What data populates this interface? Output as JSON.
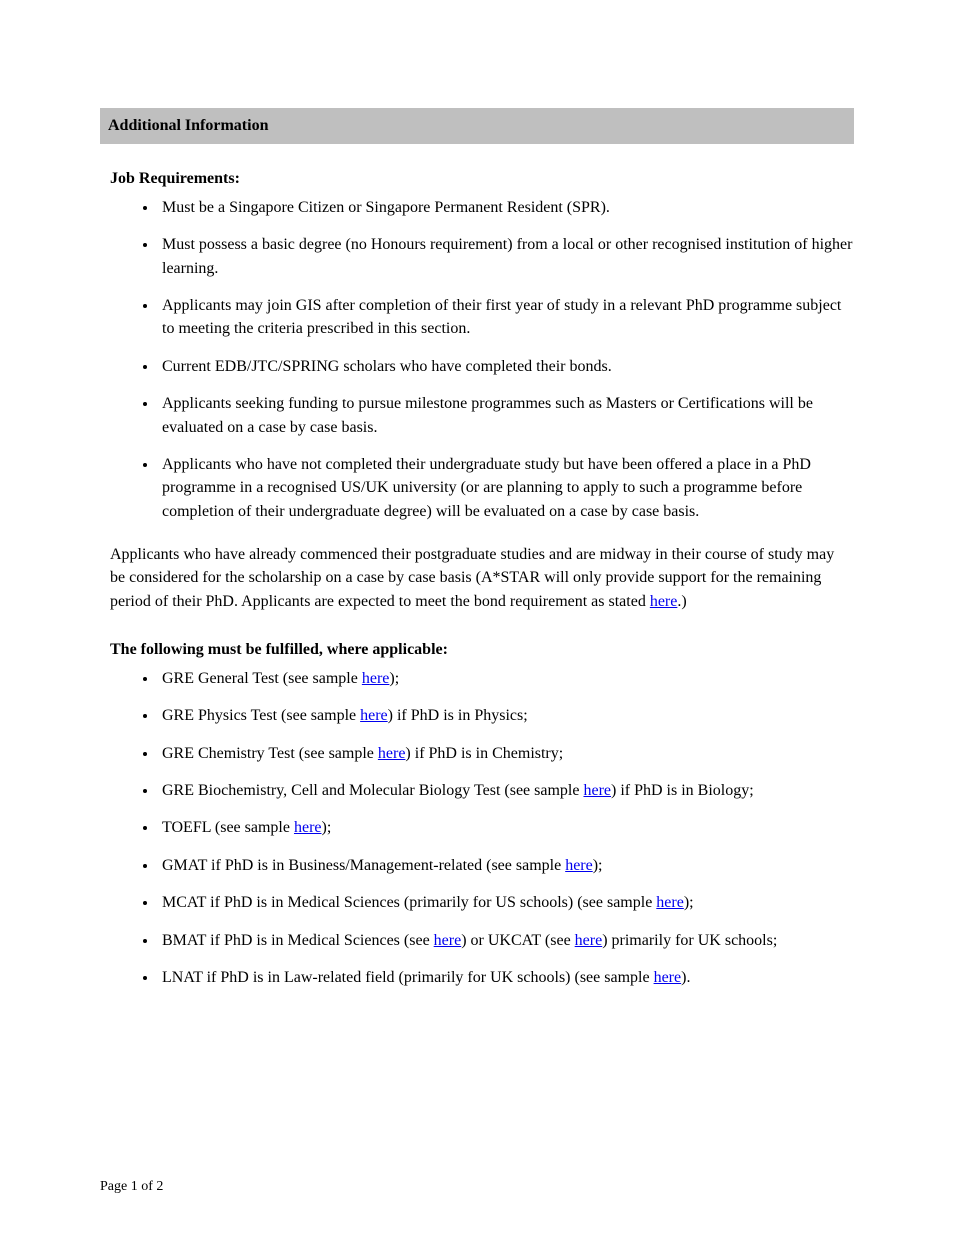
{
  "banner": "Additional Information",
  "section1": {
    "title": "Job Requirements:",
    "items": [
      "Must be a Singapore Citizen or Singapore Permanent Resident (SPR).",
      "Must possess a basic degree (no Honours requirement) from a local or other recognised institution of higher learning.",
      "Applicants may join GIS after completion of their first year of study in a relevant PhD programme subject to meeting the criteria prescribed in this section.",
      "Current EDB/JTC/SPRING scholars who have completed their bonds.",
      "Applicants seeking funding to pursue milestone programmes such as Masters or Certifications will be evaluated on a case by case basis.",
      "Applicants who have not completed their undergraduate study but have been offered a place in a PhD programme in a recognised US/UK university (or are planning to apply to such a programme before completion of their undergraduate degree) will be evaluated on a case by case basis."
    ]
  },
  "para1_pre": "Applicants who have already commenced their postgraduate studies and are midway in their course of study may be considered for the scholarship on a case by case basis (A*STAR will only provide support for the remaining period of their PhD.  Applicants are expected to meet the bond requirement as stated ",
  "para1_link": "here",
  "para1_post": ".)",
  "section2": {
    "title": "The following must be fulfilled, where applicable:",
    "items": [
      {
        "pre": "GRE General Test (see sample ",
        "link": "here",
        "post": ");"
      },
      {
        "pre": "GRE Physics Test (see sample ",
        "link": "here",
        "post": ") if PhD is in Physics;"
      },
      {
        "pre": "GRE Chemistry Test (see sample ",
        "link": "here",
        "post": ") if PhD is in Chemistry;"
      },
      {
        "pre": "GRE Biochemistry, Cell and Molecular Biology Test (see sample ",
        "link": "here",
        "post": ") if PhD is in Biology;"
      },
      {
        "pre": "TOEFL (see sample ",
        "link": "here",
        "post": ");"
      },
      {
        "pre": "GMAT if PhD is in Business/Management-related (see sample ",
        "link": "here",
        "post": ");"
      },
      {
        "pre": "MCAT if PhD is in Medical Sciences (primarily for US schools) (see sample ",
        "link": "here",
        "post": ");"
      },
      {
        "pre": "BMAT if PhD is in Medical Sciences (see ",
        "link": "here",
        "post": ") or UKCAT (see ",
        "link2": "here",
        "post2": ") primarily for UK schools;"
      },
      {
        "pre": "LNAT if PhD is in Law-related field (primarily for UK schools) (see sample ",
        "link": "here",
        "post": ")."
      }
    ]
  },
  "footer": "Page 1 of 2"
}
